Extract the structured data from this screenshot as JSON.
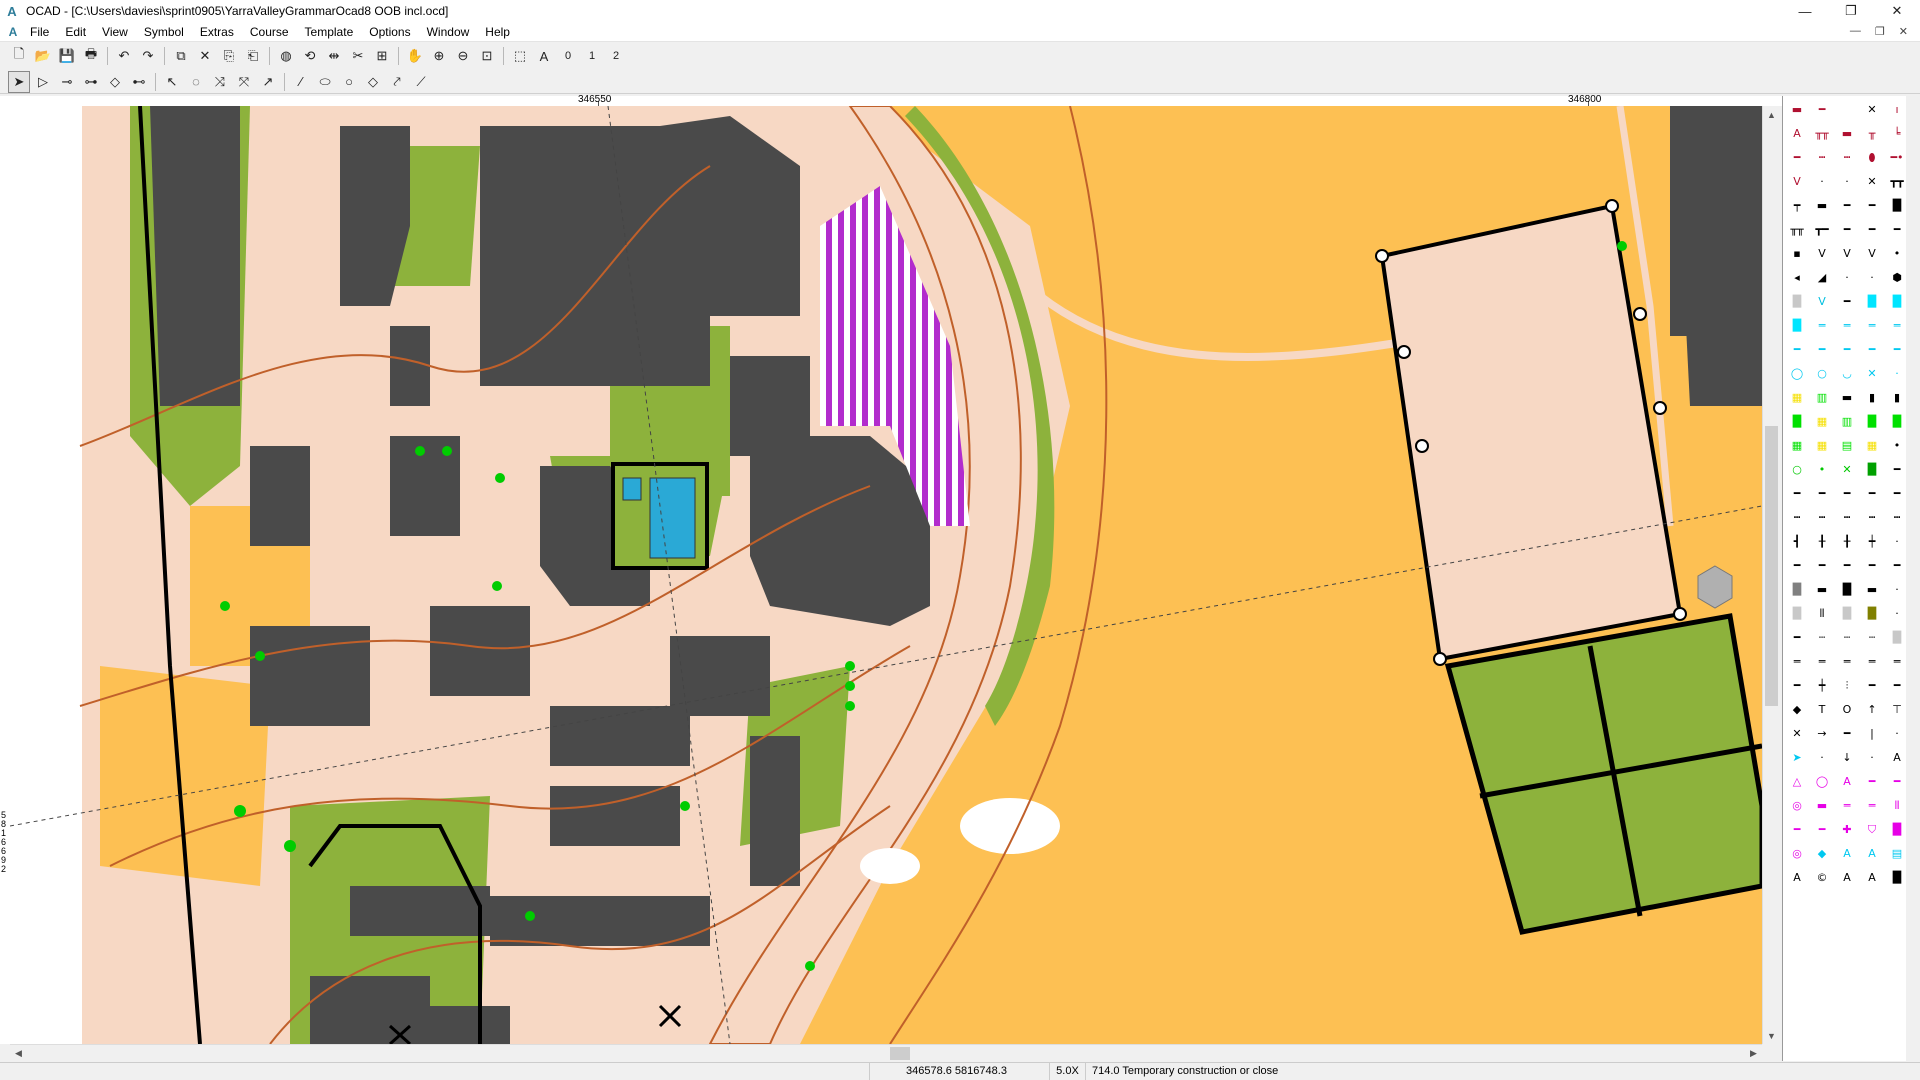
{
  "window": {
    "app_initial": "A",
    "title": "OCAD - [C:\\Users\\daviesi\\sprint0905\\YarraValleyGrammarOcad8 OOB incl.ocd]",
    "minimize": "—",
    "restore": "❐",
    "close": "✕"
  },
  "menu": {
    "doc_icon": "A",
    "items": [
      "File",
      "Edit",
      "View",
      "Symbol",
      "Extras",
      "Course",
      "Template",
      "Options",
      "Window",
      "Help"
    ],
    "child_controls": [
      "—",
      "❐",
      "✕"
    ]
  },
  "toolbar1": {
    "buttons": [
      {
        "name": "new-file-icon",
        "glyph": "🗋"
      },
      {
        "name": "open-file-icon",
        "glyph": "📂"
      },
      {
        "name": "save-icon",
        "glyph": "💾"
      },
      {
        "name": "print-icon",
        "glyph": "🖶"
      },
      {
        "name": "undo-icon",
        "glyph": "↶"
      },
      {
        "name": "redo-icon",
        "glyph": "↷"
      },
      {
        "name": "cut-icon",
        "glyph": "⧉"
      },
      {
        "name": "delete-icon",
        "glyph": "✕"
      },
      {
        "name": "copy-icon",
        "glyph": "⎘"
      },
      {
        "name": "paste-icon",
        "glyph": "⎗"
      },
      {
        "name": "fill-icon",
        "glyph": "◍"
      },
      {
        "name": "rotate-icon",
        "glyph": "⟲"
      },
      {
        "name": "stretch-icon",
        "glyph": "⇹"
      },
      {
        "name": "cut-line-icon",
        "glyph": "✂"
      },
      {
        "name": "measure-icon",
        "glyph": "⊞"
      },
      {
        "name": "hand-icon",
        "glyph": "✋"
      },
      {
        "name": "zoom-in-icon",
        "glyph": "⊕"
      },
      {
        "name": "zoom-out-icon",
        "glyph": "⊖"
      },
      {
        "name": "zoom-fit-icon",
        "glyph": "⊡"
      },
      {
        "name": "select-area-icon",
        "glyph": "⬚"
      },
      {
        "name": "text-edit-icon",
        "glyph": "A"
      }
    ],
    "levels": [
      "0",
      "1",
      "2"
    ]
  },
  "toolbar2": {
    "buttons": [
      {
        "name": "edit-object-icon",
        "glyph": "➤",
        "active": true
      },
      {
        "name": "edit-point-icon",
        "glyph": "▷"
      },
      {
        "name": "add-vertex-icon",
        "glyph": "⊸"
      },
      {
        "name": "move-vertex-icon",
        "glyph": "⊶"
      },
      {
        "name": "corner-point-icon",
        "glyph": "◇"
      },
      {
        "name": "dash-point-icon",
        "glyph": "⊷"
      },
      {
        "name": "curve-tool-icon",
        "glyph": "↖"
      },
      {
        "name": "cut-hole-icon",
        "glyph": "◌"
      },
      {
        "name": "cross-tool-icon",
        "glyph": "⤨"
      },
      {
        "name": "reshape-icon",
        "glyph": "⤧"
      },
      {
        "name": "smooth-icon",
        "glyph": "↗"
      },
      {
        "name": "draw-line-icon",
        "glyph": "∕"
      },
      {
        "name": "draw-ellipse-icon",
        "glyph": "⬭"
      },
      {
        "name": "draw-circle-icon",
        "glyph": "○"
      },
      {
        "name": "draw-rect-icon",
        "glyph": "◇"
      },
      {
        "name": "draw-freehand-icon",
        "glyph": "⤤"
      },
      {
        "name": "draw-straight-icon",
        "glyph": "⟋"
      }
    ]
  },
  "rulers": {
    "top_labels": [
      "346550",
      "346800"
    ],
    "left_label": "5816692"
  },
  "map": {
    "colors": {
      "background": "#ffffff",
      "open_land": "#fdc053",
      "paved": "#f7d8c4",
      "building": "#4a4a4a",
      "vegetation": "#8db23c",
      "contour": "#c0602a",
      "water": "#2aa9d6",
      "forbidden": "#b22ccd",
      "point_feature": "#00cc00"
    }
  },
  "statusbar": {
    "coordinates": "346578.6   5816748.3",
    "zoom": "5.0X",
    "symbol": "714.0 Temporary construction or close"
  },
  "symbolbox": {
    "symbols": [
      {
        "g": "▬",
        "c": "#b01030"
      },
      {
        "g": "━",
        "c": "#b01030"
      },
      {
        "g": "",
        "c": ""
      },
      {
        "g": "✕",
        "c": "#000"
      },
      {
        "g": "ı",
        "c": "#b01030"
      },
      {
        "g": "A",
        "c": "#b01030"
      },
      {
        "g": "╥╥",
        "c": "#b01030"
      },
      {
        "g": "▬",
        "c": "#b01030"
      },
      {
        "g": "╥",
        "c": "#b01030"
      },
      {
        "g": "╘",
        "c": "#b01030"
      },
      {
        "g": "━",
        "c": "#b01030"
      },
      {
        "g": "┅",
        "c": "#b01030"
      },
      {
        "g": "┅",
        "c": "#b01030"
      },
      {
        "g": "⬮",
        "c": "#b01030"
      },
      {
        "g": "━•",
        "c": "#b01030"
      },
      {
        "g": "V",
        "c": "#b01030"
      },
      {
        "g": "·",
        "c": "#000"
      },
      {
        "g": "·",
        "c": "#000"
      },
      {
        "g": "✕",
        "c": "#000"
      },
      {
        "g": "┳┳",
        "c": "#000"
      },
      {
        "g": "┯",
        "c": "#000"
      },
      {
        "g": "▬",
        "c": "#000"
      },
      {
        "g": "━",
        "c": "#000"
      },
      {
        "g": "━",
        "c": "#000"
      },
      {
        "g": "█",
        "c": "#000"
      },
      {
        "g": "╥╥",
        "c": "#000"
      },
      {
        "g": "┳━",
        "c": "#000"
      },
      {
        "g": "━",
        "c": "#000"
      },
      {
        "g": "━",
        "c": "#000"
      },
      {
        "g": "━",
        "c": "#000"
      },
      {
        "g": "▪",
        "c": "#000"
      },
      {
        "g": "V",
        "c": "#000"
      },
      {
        "g": "V",
        "c": "#000"
      },
      {
        "g": "V",
        "c": "#000"
      },
      {
        "g": "•",
        "c": "#000"
      },
      {
        "g": "◂",
        "c": "#000"
      },
      {
        "g": "◢",
        "c": "#000"
      },
      {
        "g": "·",
        "c": "#000"
      },
      {
        "g": "·",
        "c": "#000"
      },
      {
        "g": "⬢",
        "c": "#000"
      },
      {
        "g": "█",
        "c": "#c8c8c8"
      },
      {
        "g": "V",
        "c": "#00bfe0"
      },
      {
        "g": "━",
        "c": "#000"
      },
      {
        "g": "█",
        "c": "#00e5ff"
      },
      {
        "g": "█",
        "c": "#00e5ff"
      },
      {
        "g": "█",
        "c": "#00e5ff"
      },
      {
        "g": "═",
        "c": "#00c8f0"
      },
      {
        "g": "═",
        "c": "#00c8f0"
      },
      {
        "g": "═",
        "c": "#00c8f0"
      },
      {
        "g": "═",
        "c": "#00c8f0"
      },
      {
        "g": "━",
        "c": "#00c8f0"
      },
      {
        "g": "━",
        "c": "#00c8f0"
      },
      {
        "g": "━",
        "c": "#00c8f0"
      },
      {
        "g": "━",
        "c": "#00c8f0"
      },
      {
        "g": "━",
        "c": "#00c8f0"
      },
      {
        "g": "◯",
        "c": "#00c8f0"
      },
      {
        "g": "○",
        "c": "#00c8f0"
      },
      {
        "g": "◡",
        "c": "#00c8f0"
      },
      {
        "g": "✕",
        "c": "#00c8f0"
      },
      {
        "g": "·",
        "c": "#00c8f0"
      },
      {
        "g": "▦",
        "c": "#f5e000"
      },
      {
        "g": "▥",
        "c": "#00e000"
      },
      {
        "g": "▬",
        "c": "#000"
      },
      {
        "g": "▮",
        "c": "#000"
      },
      {
        "g": "▮",
        "c": "#000"
      },
      {
        "g": "█",
        "c": "#00e000"
      },
      {
        "g": "▦",
        "c": "#f5e000"
      },
      {
        "g": "▥",
        "c": "#00e000"
      },
      {
        "g": "█",
        "c": "#00e000"
      },
      {
        "g": "█",
        "c": "#00e000"
      },
      {
        "g": "▦",
        "c": "#00e000"
      },
      {
        "g": "▦",
        "c": "#f5e000"
      },
      {
        "g": "▤",
        "c": "#00e000"
      },
      {
        "g": "▦",
        "c": "#f5e000"
      },
      {
        "g": "•",
        "c": "#000"
      },
      {
        "g": "○",
        "c": "#00c800"
      },
      {
        "g": "•",
        "c": "#00c800"
      },
      {
        "g": "✕",
        "c": "#00c800"
      },
      {
        "g": "█",
        "c": "#00a000"
      },
      {
        "g": "━",
        "c": "#000"
      },
      {
        "g": "━",
        "c": "#000"
      },
      {
        "g": "━",
        "c": "#000"
      },
      {
        "g": "━",
        "c": "#000"
      },
      {
        "g": "━",
        "c": "#000"
      },
      {
        "g": "━",
        "c": "#000"
      },
      {
        "g": "┅",
        "c": "#000"
      },
      {
        "g": "┅",
        "c": "#000"
      },
      {
        "g": "┅",
        "c": "#000"
      },
      {
        "g": "┅",
        "c": "#000"
      },
      {
        "g": "┅",
        "c": "#000"
      },
      {
        "g": "┫",
        "c": "#000"
      },
      {
        "g": "╂",
        "c": "#000"
      },
      {
        "g": "╂",
        "c": "#000"
      },
      {
        "g": "┿",
        "c": "#000"
      },
      {
        "g": "·",
        "c": "#000"
      },
      {
        "g": "━",
        "c": "#000"
      },
      {
        "g": "━",
        "c": "#000"
      },
      {
        "g": "━",
        "c": "#000"
      },
      {
        "g": "━",
        "c": "#000"
      },
      {
        "g": "━",
        "c": "#000"
      },
      {
        "g": "█",
        "c": "#808080"
      },
      {
        "g": "▬",
        "c": "#000"
      },
      {
        "g": "█",
        "c": "#000"
      },
      {
        "g": "▬",
        "c": "#000"
      },
      {
        "g": "·",
        "c": "#000"
      },
      {
        "g": "█",
        "c": "#c8c8c8"
      },
      {
        "g": "⦀",
        "c": "#000"
      },
      {
        "g": "█",
        "c": "#c8c8c8"
      },
      {
        "g": "█",
        "c": "#808000"
      },
      {
        "g": "·",
        "c": "#000"
      },
      {
        "g": "━",
        "c": "#000"
      },
      {
        "g": "┄",
        "c": "#000"
      },
      {
        "g": "┄",
        "c": "#000"
      },
      {
        "g": "┄",
        "c": "#000"
      },
      {
        "g": "█",
        "c": "#c8c8c8"
      },
      {
        "g": "═",
        "c": "#000"
      },
      {
        "g": "═",
        "c": "#000"
      },
      {
        "g": "═",
        "c": "#000"
      },
      {
        "g": "═",
        "c": "#000"
      },
      {
        "g": "═",
        "c": "#000"
      },
      {
        "g": "━",
        "c": "#000"
      },
      {
        "g": "┿",
        "c": "#000"
      },
      {
        "g": "⫶",
        "c": "#000"
      },
      {
        "g": "━",
        "c": "#000"
      },
      {
        "g": "━",
        "c": "#000"
      },
      {
        "g": "◆",
        "c": "#000"
      },
      {
        "g": "T",
        "c": "#000"
      },
      {
        "g": "O",
        "c": "#000"
      },
      {
        "g": "↑",
        "c": "#000"
      },
      {
        "g": "⊤",
        "c": "#000"
      },
      {
        "g": "✕",
        "c": "#000"
      },
      {
        "g": "→",
        "c": "#000"
      },
      {
        "g": "━",
        "c": "#000"
      },
      {
        "g": "|",
        "c": "#000"
      },
      {
        "g": "·",
        "c": "#000"
      },
      {
        "g": "➤",
        "c": "#00c8f0"
      },
      {
        "g": "·",
        "c": "#000"
      },
      {
        "g": "↓",
        "c": "#000"
      },
      {
        "g": "·",
        "c": "#000"
      },
      {
        "g": "A",
        "c": "#000"
      },
      {
        "g": "△",
        "c": "#e600e6"
      },
      {
        "g": "◯",
        "c": "#e600e6"
      },
      {
        "g": "A",
        "c": "#e600e6"
      },
      {
        "g": "━",
        "c": "#e600e6"
      },
      {
        "g": "━",
        "c": "#e600e6"
      },
      {
        "g": "◎",
        "c": "#e600e6"
      },
      {
        "g": "▬",
        "c": "#e600e6"
      },
      {
        "g": "═",
        "c": "#e600e6"
      },
      {
        "g": "═",
        "c": "#e600e6"
      },
      {
        "g": "⦀",
        "c": "#e600e6"
      },
      {
        "g": "━",
        "c": "#e600e6"
      },
      {
        "g": "━",
        "c": "#e600e6"
      },
      {
        "g": "✚",
        "c": "#e600e6"
      },
      {
        "g": "⛉",
        "c": "#e600e6"
      },
      {
        "g": "█",
        "c": "#e600e6"
      },
      {
        "g": "◎",
        "c": "#e600e6"
      },
      {
        "g": "◆",
        "c": "#00c8f0"
      },
      {
        "g": "A",
        "c": "#00c8f0"
      },
      {
        "g": "A",
        "c": "#00c8f0"
      },
      {
        "g": "▤",
        "c": "#00c8f0"
      },
      {
        "g": "A",
        "c": "#000"
      },
      {
        "g": "©",
        "c": "#000"
      },
      {
        "g": "A",
        "c": "#000"
      },
      {
        "g": "A",
        "c": "#000"
      },
      {
        "g": "█",
        "c": "#000"
      }
    ]
  }
}
